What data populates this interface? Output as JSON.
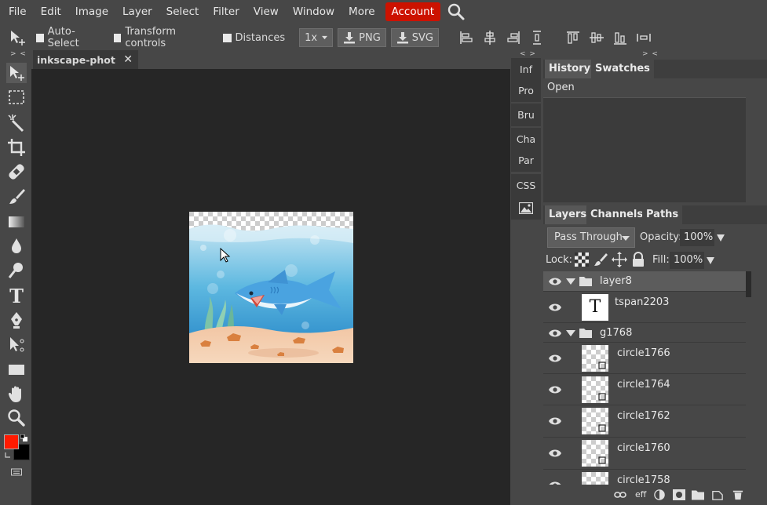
{
  "menu": {
    "items": [
      "File",
      "Edit",
      "Image",
      "Layer",
      "Select",
      "Filter",
      "View",
      "Window",
      "More"
    ],
    "account_label": "Account"
  },
  "options": {
    "auto_select": "Auto-Select",
    "transform_controls": "Transform controls",
    "distances": "Distances",
    "zoom": "1x",
    "png": "PNG",
    "svg": "SVG"
  },
  "strips": {
    "left": "> <",
    "mini": "< >",
    "right": "> <"
  },
  "document": {
    "tab_title": "inkscape-photo",
    "close": "✕"
  },
  "mini_panels": [
    "Inf",
    "Pro",
    "Bru",
    "Cha",
    "Par",
    "CSS"
  ],
  "history": {
    "tabs": [
      "History",
      "Swatches"
    ],
    "entries": [
      "Open"
    ]
  },
  "layers": {
    "tabs": [
      "Layers",
      "Channels",
      "Paths"
    ],
    "blend_mode": "Pass Through",
    "opacity_label": "Opacity:",
    "opacity": "100%",
    "lock_label": "Lock:",
    "fill_label": "Fill:",
    "fill": "100%",
    "rows": [
      {
        "name": "layer8",
        "type": "group"
      },
      {
        "name": "tspan2203",
        "type": "text",
        "thumb": "T"
      },
      {
        "name": "g1768",
        "type": "group"
      },
      {
        "name": "circle1766",
        "type": "shape"
      },
      {
        "name": "circle1764",
        "type": "shape"
      },
      {
        "name": "circle1762",
        "type": "shape"
      },
      {
        "name": "circle1760",
        "type": "shape"
      },
      {
        "name": "circle1758",
        "type": "shape"
      }
    ]
  },
  "footer": {
    "effects_label": "eff"
  },
  "colors": {
    "foreground": "#ff1a00",
    "background": "#000000",
    "account": "#cc1200"
  }
}
